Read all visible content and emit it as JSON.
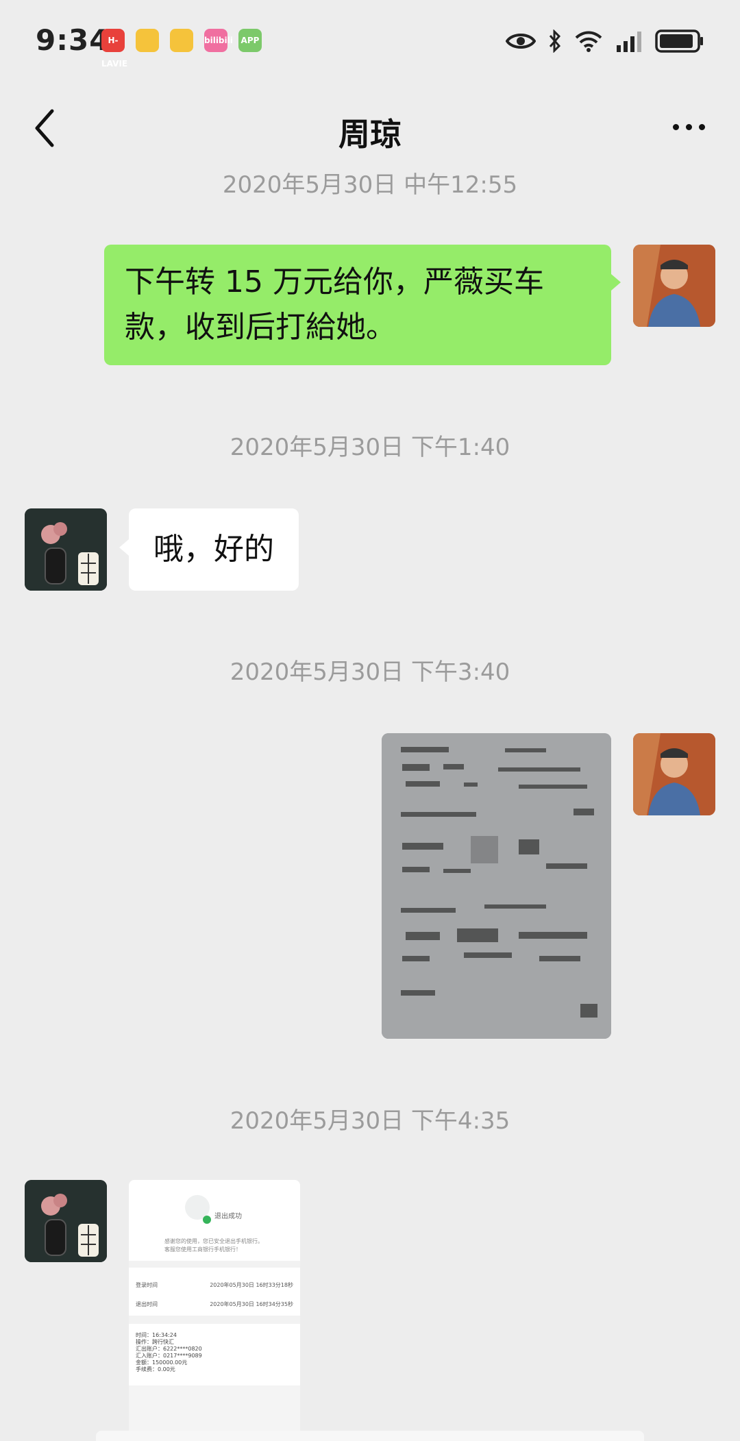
{
  "status_bar": {
    "time": "9:34",
    "notification_icons": [
      "app-icon-red",
      "weibo-icon",
      "weibo-icon",
      "bilibili-icon",
      "app-icon-green"
    ],
    "notif_labels": [
      "H-LAVIE",
      "",
      "",
      "bilibili",
      "APP"
    ],
    "right_icons": [
      "eye-icon",
      "bluetooth-icon",
      "wifi-icon",
      "signal-icon",
      "battery-icon"
    ]
  },
  "nav": {
    "title": "周琼",
    "back_icon": "chevron-left-icon",
    "more_icon": "more-icon"
  },
  "messages": [
    {
      "type": "timestamp",
      "text": "2020年5月30日 中午12:55"
    },
    {
      "type": "text",
      "from": "me",
      "text": "下午转 15 万元给你，严薇买车款，收到后打給她。"
    },
    {
      "type": "timestamp",
      "text": "2020年5月30日 下午1:40"
    },
    {
      "type": "text",
      "from": "contact",
      "text": "哦，好的"
    },
    {
      "type": "timestamp",
      "text": "2020年5月30日 下午3:40"
    },
    {
      "type": "image",
      "from": "me",
      "description": "blurred-document-photo"
    },
    {
      "type": "timestamp",
      "text": "2020年5月30日 下午4:35"
    },
    {
      "type": "image",
      "from": "contact",
      "description": "bank-transfer-screenshot"
    }
  ],
  "receipt": {
    "heading": "退出成功",
    "notice_line1": "感谢您的使用，您已安全退出手机银行。",
    "notice_line2": "客服您使用工商银行手机银行！",
    "login_label": "登录时间",
    "login_value": "2020年05月30日 16时33分18秒",
    "logout_label": "退出时间",
    "logout_value": "2020年05月30日 16时34分35秒",
    "details": [
      "时间：16:34:24",
      "操作：跨行快汇",
      "汇出账户：6222****0820",
      "汇入账户：0217****9089",
      "金额：150000.00元",
      "手续费：0.00元"
    ]
  },
  "colors": {
    "background": "#ededed",
    "sent_bubble": "#95ec69",
    "received_bubble": "#ffffff",
    "timestamp_text": "#9b9b9b"
  }
}
